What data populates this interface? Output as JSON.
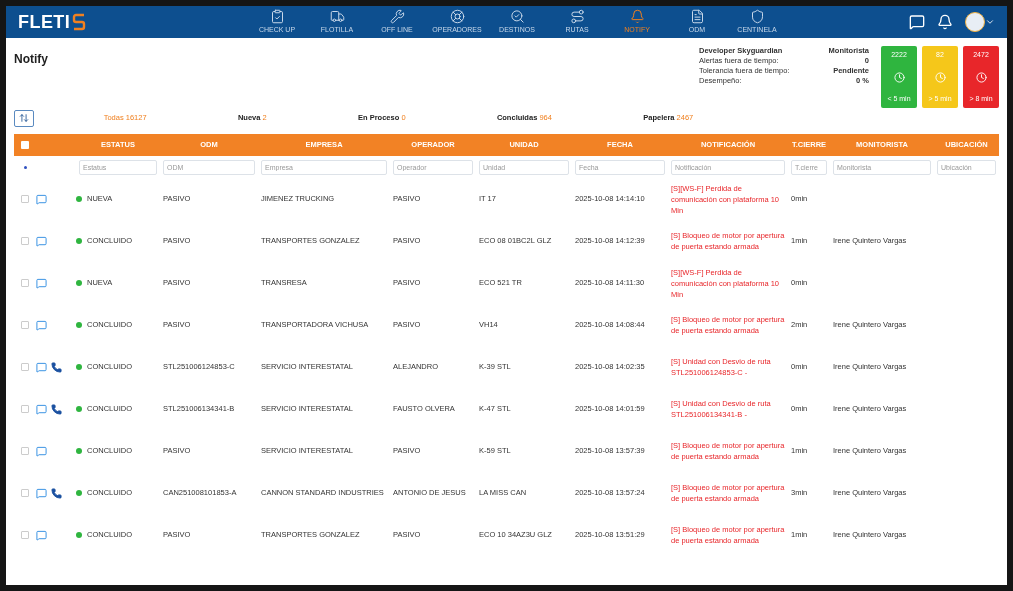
{
  "app": {
    "logo": "FLETI"
  },
  "nav": [
    {
      "label": "CHECK UP",
      "selected": false
    },
    {
      "label": "FLOTILLA",
      "selected": false
    },
    {
      "label": "OFF LINE",
      "selected": false
    },
    {
      "label": "OPERADORES",
      "selected": false
    },
    {
      "label": "DESTINOS",
      "selected": false
    },
    {
      "label": "RUTAS",
      "selected": false
    },
    {
      "label": "NOTIFY",
      "selected": true
    },
    {
      "label": "ODM",
      "selected": false
    },
    {
      "label": "CENTINELA",
      "selected": false
    }
  ],
  "page_title": "Notify",
  "summary": {
    "user": "Developer Skyguardian",
    "role": "Monitorista",
    "rows": [
      {
        "label": "Alertas fuera de tiempo:",
        "value": "0"
      },
      {
        "label": "Tolerancia fuera de tiempo:",
        "value": "Pendiente"
      },
      {
        "label": "Desempeño:",
        "value": "0 %"
      }
    ]
  },
  "timers": [
    {
      "count": "2222",
      "label": "< 5 min",
      "color": "#2fb53f"
    },
    {
      "count": "82",
      "label": "> 5 min",
      "color": "#f5c71a"
    },
    {
      "count": "2472",
      "label": "> 8 min",
      "color": "#e8262a"
    }
  ],
  "filters": [
    {
      "label": "Todas",
      "count": "16127",
      "selected": true
    },
    {
      "label": "Nueva",
      "count": "2",
      "selected": false
    },
    {
      "label": "En Proceso",
      "count": "0",
      "selected": false
    },
    {
      "label": "Concluidas",
      "count": "964",
      "selected": false
    },
    {
      "label": "Papelera",
      "count": "2467",
      "selected": false
    }
  ],
  "table": {
    "all_checked": false,
    "columns": [
      "ESTATUS",
      "ODM",
      "EMPRESA",
      "OPERADOR",
      "UNIDAD",
      "FECHA",
      "NOTIFICACIÓN",
      "T.CIERRE",
      "MONITORISTA",
      "UBICACIÓN"
    ],
    "filter_placeholders": [
      "Estatus",
      "ODM",
      "Empresa",
      "Operador",
      "Unidad",
      "Fecha",
      "Notificación",
      "T.cierre",
      "Monitorista",
      "Ubicación"
    ],
    "rows": [
      {
        "checked": false,
        "phone": false,
        "status": "NUEVA",
        "color": "#2fb53f",
        "odm": "PASIVO",
        "empresa": "JIMENEZ TRUCKING",
        "operador": "PASIVO",
        "unidad": "IT 17",
        "fecha": "2025-10-08 14:14:10",
        "notificacion": "[S][WS-F] Perdida de comunicación con plataforma 10 Min",
        "t_cierre": "0min",
        "monitorista": ""
      },
      {
        "checked": false,
        "phone": false,
        "status": "CONCLUIDO",
        "color": "#2fb53f",
        "odm": "PASIVO",
        "empresa": "TRANSPORTES GONZALEZ",
        "operador": "PASIVO",
        "unidad": "ECO 08 01BC2L GLZ",
        "fecha": "2025-10-08 14:12:39",
        "notificacion": "[S] Bloqueo de motor por apertura de puerta estando armada",
        "t_cierre": "1min",
        "monitorista": "Irene Quintero Vargas"
      },
      {
        "checked": false,
        "phone": false,
        "status": "NUEVA",
        "color": "#2fb53f",
        "odm": "PASIVO",
        "empresa": "TRANSRESA",
        "operador": "PASIVO",
        "unidad": "ECO 521 TR",
        "fecha": "2025-10-08 14:11:30",
        "notificacion": "[S][WS-F] Perdida de comunicación con plataforma 10 Min",
        "t_cierre": "0min",
        "monitorista": ""
      },
      {
        "checked": false,
        "phone": false,
        "status": "CONCLUIDO",
        "color": "#2fb53f",
        "odm": "PASIVO",
        "empresa": "TRANSPORTADORA VICHUSA",
        "operador": "PASIVO",
        "unidad": "VH14",
        "fecha": "2025-10-08 14:08:44",
        "notificacion": "[S] Bloqueo de motor por apertura de puerta estando armada",
        "t_cierre": "2min",
        "monitorista": "Irene Quintero Vargas"
      },
      {
        "checked": false,
        "phone": true,
        "status": "CONCLUIDO",
        "color": "#2fb53f",
        "odm": "STL251006124853-C",
        "empresa": "SERVICIO INTERESTATAL",
        "operador": "ALEJANDRO",
        "unidad": "K-39 STL",
        "fecha": "2025-10-08 14:02:35",
        "notificacion": "[S] Unidad con Desvio de ruta STL251006124853-C -",
        "t_cierre": "0min",
        "monitorista": "Irene Quintero Vargas"
      },
      {
        "checked": false,
        "phone": true,
        "status": "CONCLUIDO",
        "color": "#2fb53f",
        "odm": "STL251006134341-B",
        "empresa": "SERVICIO INTERESTATAL",
        "operador": "FAUSTO OLVERA",
        "unidad": "K-47 STL",
        "fecha": "2025-10-08 14:01:59",
        "notificacion": "[S] Unidad con Desvio de ruta STL251006134341-B -",
        "t_cierre": "0min",
        "monitorista": "Irene Quintero Vargas"
      },
      {
        "checked": false,
        "phone": false,
        "status": "CONCLUIDO",
        "color": "#2fb53f",
        "odm": "PASIVO",
        "empresa": "SERVICIO INTERESTATAL",
        "operador": "PASIVO",
        "unidad": "K-59 STL",
        "fecha": "2025-10-08 13:57:39",
        "notificacion": "[S] Bloqueo de motor por apertura de puerta estando armada",
        "t_cierre": "1min",
        "monitorista": "Irene Quintero Vargas"
      },
      {
        "checked": false,
        "phone": true,
        "status": "CONCLUIDO",
        "color": "#2fb53f",
        "odm": "CAN251008101853-A",
        "empresa": "CANNON STANDARD INDUSTRIES",
        "operador": "ANTONIO DE JESUS",
        "unidad": "LA MISS CAN",
        "fecha": "2025-10-08 13:57:24",
        "notificacion": "[S] Bloqueo de motor por apertura de puerta estando armada",
        "t_cierre": "3min",
        "monitorista": "Irene Quintero Vargas"
      },
      {
        "checked": false,
        "phone": false,
        "status": "CONCLUIDO",
        "color": "#2fb53f",
        "odm": "PASIVO",
        "empresa": "TRANSPORTES GONZALEZ",
        "operador": "PASIVO",
        "unidad": "ECO 10 34AZ3U GLZ",
        "fecha": "2025-10-08 13:51:29",
        "notificacion": "[S] Bloqueo de motor por apertura de puerta estando armada",
        "t_cierre": "1min",
        "monitorista": "Irene Quintero Vargas"
      }
    ]
  }
}
